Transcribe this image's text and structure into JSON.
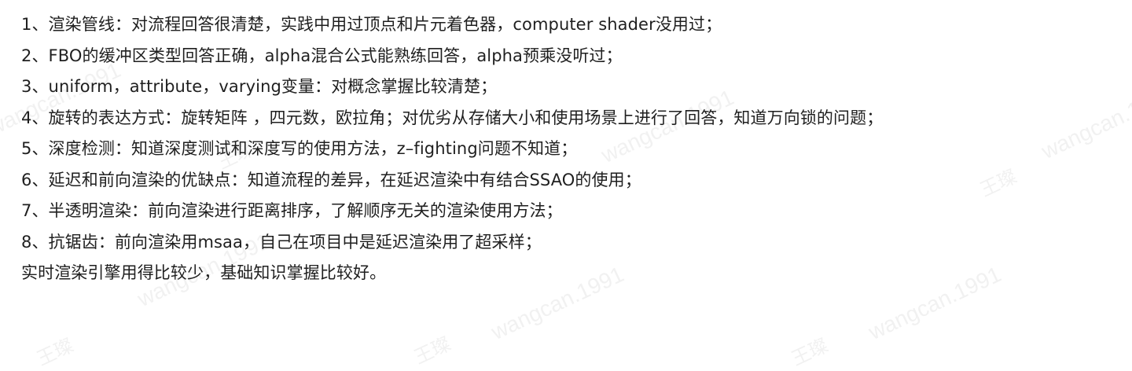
{
  "document": {
    "lines": [
      "1、渲染管线：对流程回答很清楚，实践中用过顶点和片元着色器，computer shader没用过；",
      "2、FBO的缓冲区类型回答正确，alpha混合公式能熟练回答，alpha预乘没听过；",
      "3、uniform，attribute，varying变量：对概念掌握比较清楚；",
      "4、旋转的表达方式：旋转矩阵 ，四元数，欧拉角；对优劣从存储大小和使用场景上进行了回答，知道万向锁的问题；",
      "5、深度检测：知道深度测试和深度写的使用方法，z–fighting问题不知道；",
      "6、延迟和前向渲染的优缺点：知道流程的差异，在延迟渲染中有结合SSAO的使用；",
      "7、半透明渲染：前向渲染进行距离排序，了解顺序无关的渲染使用方法；",
      "8、抗锯齿：前向渲染用msaa，自己在项目中是延迟渲染用了超采样；",
      "实时渲染引擎用得比较少，基础知识掌握比较好。"
    ]
  },
  "watermark": {
    "handle": "wangcan.1991",
    "name": "王璨"
  }
}
